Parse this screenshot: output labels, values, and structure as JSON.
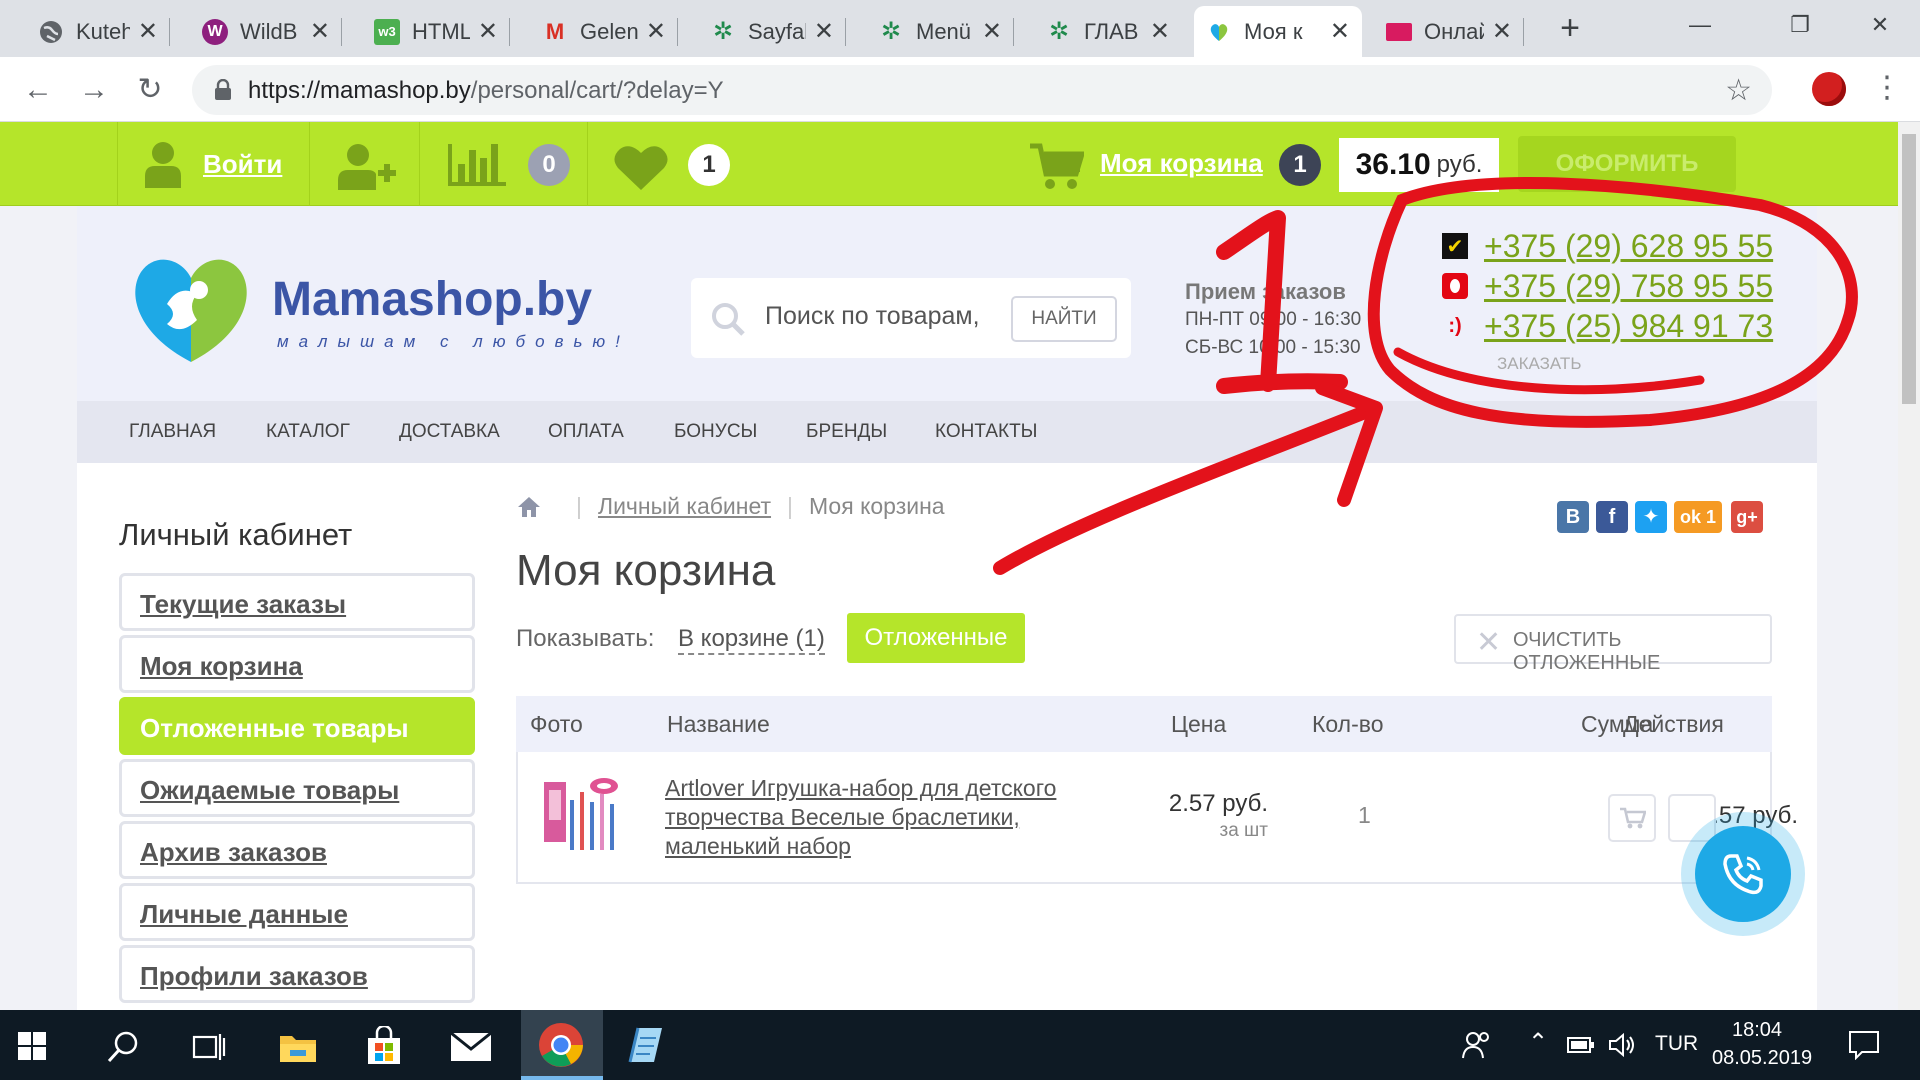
{
  "browser": {
    "tabs": [
      {
        "title": "Kuteh",
        "icon": "globe-icon",
        "color": "#5f6368"
      },
      {
        "title": "WildB",
        "icon": "wildberries-icon",
        "color": "#8e1f7e"
      },
      {
        "title": "HTML",
        "icon": "w3-icon",
        "color": "#4caf50"
      },
      {
        "title": "Gelen",
        "icon": "gmail-icon",
        "color": "#d93025"
      },
      {
        "title": "Sayfal",
        "icon": "pattern-icon",
        "color": "#1f8a4c"
      },
      {
        "title": "Menü",
        "icon": "pattern-icon",
        "color": "#1f8a4c"
      },
      {
        "title": "ГЛАВ",
        "icon": "pattern-icon",
        "color": "#1f8a4c"
      },
      {
        "title": "Моя к",
        "icon": "mamashop-icon",
        "color": "#1ea9e6"
      },
      {
        "title": "Онлай",
        "icon": "online-icon",
        "color": "#d81b60"
      }
    ],
    "url_domain": "https://mamashop.by",
    "url_path": "/personal/cart/?delay=Y"
  },
  "topbar": {
    "login": "Войти",
    "compare_count": "0",
    "wishlist_count": "1",
    "cart_label": "Моя корзина",
    "cart_count": "1",
    "cart_total": "36.10",
    "currency": "руб.",
    "checkout": "ОФОРМИТЬ"
  },
  "header": {
    "logo": "Mamashop.by",
    "tagline": "малышам с любовью!",
    "search_placeholder": "Поиск по товарам,",
    "search_button": "НАЙТИ",
    "hours_title": "Прием заказов",
    "hours_weekdays": "ПН-ПТ 09:00 - 16:30",
    "hours_weekend": "СБ-ВС 10:00 - 15:30",
    "phones": [
      "+375 (29) 628 95 55",
      "+375 (29) 758 95 55",
      "+375 (25) 984 91 73"
    ],
    "callback": "ЗАКАЗАТЬ"
  },
  "menu": [
    "ГЛАВНАЯ",
    "КАТАЛОГ",
    "ДОСТАВКА",
    "ОПЛАТА",
    "БОНУСЫ",
    "БРЕНДЫ",
    "КОНТАКТЫ"
  ],
  "sidebar": {
    "title": "Личный кабинет",
    "items": [
      "Текущие заказы",
      "Моя корзина",
      "Отложенные товары",
      "Ожидаемые товары",
      "Архив заказов",
      "Личные данные",
      "Профили заказов"
    ],
    "active_index": 2
  },
  "breadcrumb": {
    "link": "Личный кабинет",
    "current": "Моя корзина"
  },
  "share_count": "1",
  "cart": {
    "title": "Моя корзина",
    "show_label": "Показывать:",
    "filter_in_cart": "В корзине (1)",
    "filter_delayed": "Отложенные",
    "clear_button": "ОЧИСТИТЬ ОТЛОЖЕННЫЕ",
    "columns": [
      "Фото",
      "Название",
      "Цена",
      "Кол-во",
      "Сумма",
      "Действия"
    ],
    "rows": [
      {
        "name": "Artlover Игрушка-набор для детского творчества Веселые браслетики, маленький набор",
        "price": "2.57 руб.",
        "unit": "за шт",
        "qty": "1",
        "sum": "2.57 руб."
      }
    ]
  },
  "annotation_text": "1",
  "taskbar": {
    "lang": "TUR",
    "time": "18:04",
    "date": "08.05.2019"
  },
  "colors": {
    "accent": "#b5e52a",
    "phone": "#7aa31a",
    "annotation": "#e3121b",
    "fab": "#1ea9e6"
  }
}
